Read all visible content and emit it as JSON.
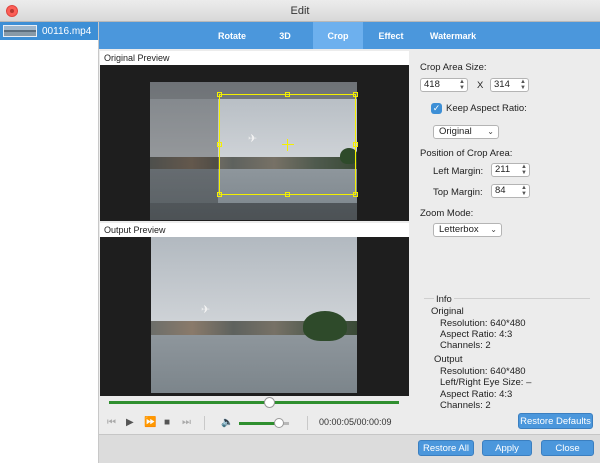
{
  "window": {
    "title": "Edit"
  },
  "file_list": {
    "items": [
      {
        "name": "00116.mp4",
        "selected": true
      }
    ]
  },
  "tabs": [
    {
      "label": "Rotate",
      "active": false
    },
    {
      "label": "3D",
      "active": false
    },
    {
      "label": "Crop",
      "active": true
    },
    {
      "label": "Effect",
      "active": false
    },
    {
      "label": "Watermark",
      "active": false
    }
  ],
  "original_preview": {
    "label": "Original Preview"
  },
  "output_preview": {
    "label": "Output Preview"
  },
  "playback": {
    "progress": 0.55,
    "volume": 0.8,
    "time": "00:00:05/00:00:09"
  },
  "crop": {
    "area_size_label": "Crop Area Size:",
    "width": "418",
    "separator": "X",
    "height": "314",
    "keep_aspect_label": "Keep Aspect Ratio:",
    "keep_aspect_checked": true,
    "aspect_option": "Original",
    "position_label": "Position of Crop Area:",
    "left_margin_label": "Left Margin:",
    "left_margin": "211",
    "top_margin_label": "Top Margin:",
    "top_margin": "84",
    "zoom_label": "Zoom Mode:",
    "zoom_option": "Letterbox"
  },
  "info": {
    "legend": "Info",
    "original_heading": "Original",
    "original_resolution": "Resolution: 640*480",
    "original_aspect": "Aspect Ratio: 4:3",
    "original_channels": "Channels: 2",
    "output_heading": "Output",
    "output_resolution": "Resolution: 640*480",
    "output_eye": "Left/Right Eye Size: –",
    "output_aspect": "Aspect Ratio: 4:3",
    "output_channels": "Channels: 2"
  },
  "buttons": {
    "restore_defaults": "Restore Defaults",
    "restore_all": "Restore All",
    "apply": "Apply",
    "close": "Close"
  },
  "colors": {
    "accent": "#4b97dc",
    "crop_outline": "#f4f000",
    "progress": "#2f8f2f"
  }
}
